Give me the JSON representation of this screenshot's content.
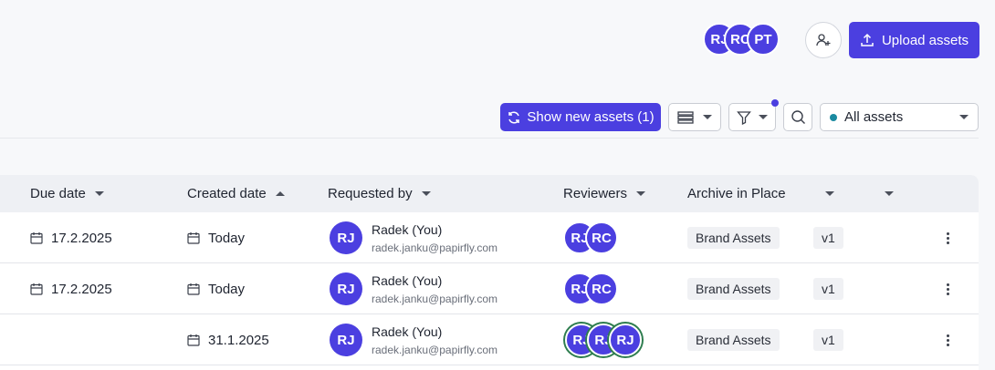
{
  "header": {
    "collaborators": [
      "RJ",
      "RC",
      "PT"
    ],
    "upload_label": "Upload assets"
  },
  "toolbar": {
    "new_assets_label": "Show new assets (1)",
    "filter_select_value": "All assets"
  },
  "table": {
    "columns": [
      "Due date",
      "Created date",
      "Requested by",
      "Reviewers",
      "Archive in Place"
    ],
    "rows": [
      {
        "due": "17.2.2025",
        "created": "Today",
        "initials": "RJ",
        "name": "Radek (You)",
        "email": "radek.janku@papirfly.com",
        "reviewers": [
          "RJ",
          "RC"
        ],
        "archive": "Brand Assets",
        "version": "v1"
      },
      {
        "due": "17.2.2025",
        "created": "Today",
        "initials": "RJ",
        "name": "Radek (You)",
        "email": "radek.janku@papirfly.com",
        "reviewers": [
          "RJ",
          "RC"
        ],
        "archive": "Brand Assets",
        "version": "v1"
      },
      {
        "due": "",
        "created": "31.1.2025",
        "initials": "RJ",
        "name": "Radek (You)",
        "email": "radek.janku@papirfly.com",
        "reviewers": [
          "RJ",
          "RJ",
          "RJ"
        ],
        "archive": "Brand Assets",
        "version": "v1"
      }
    ]
  },
  "colors": {
    "accent": "#4b3fe0",
    "reviewer_ring": "#2e7d4f",
    "status_dot": "#1a8aa0"
  }
}
